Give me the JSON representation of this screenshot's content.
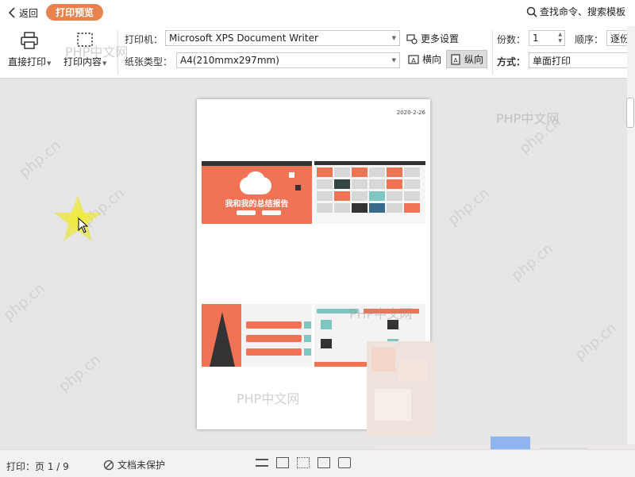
{
  "topbar": {
    "back_label": "返回",
    "mode_label": "打印预览",
    "search_label": "查找命令、搜索模板"
  },
  "toolbar": {
    "direct_print": "直接打印",
    "print_content": "打印内容",
    "printer_label": "打印机：",
    "printer_value": "Microsoft XPS Document Writer",
    "paper_label": "纸张类型：",
    "paper_value": "A4(210mmx297mm)",
    "more_settings": "更多设置",
    "landscape": "横向",
    "portrait": "纵向",
    "copies_label": "份数：",
    "copies_value": "1",
    "order_label": "顺序：",
    "order_value": "逐份",
    "mode_label": "方式：",
    "mode_value": "单面打印"
  },
  "page": {
    "date": "2020-2-26",
    "slide1_title": "我和我的总结报告"
  },
  "watermarks": [
    "PHP中文网",
    "php.cn"
  ],
  "status": {
    "page_info": "打印：页 1 / 9",
    "protect": "文档未保护"
  },
  "colors": {
    "accent": "#e8834d",
    "slide_orange": "#f07355"
  }
}
